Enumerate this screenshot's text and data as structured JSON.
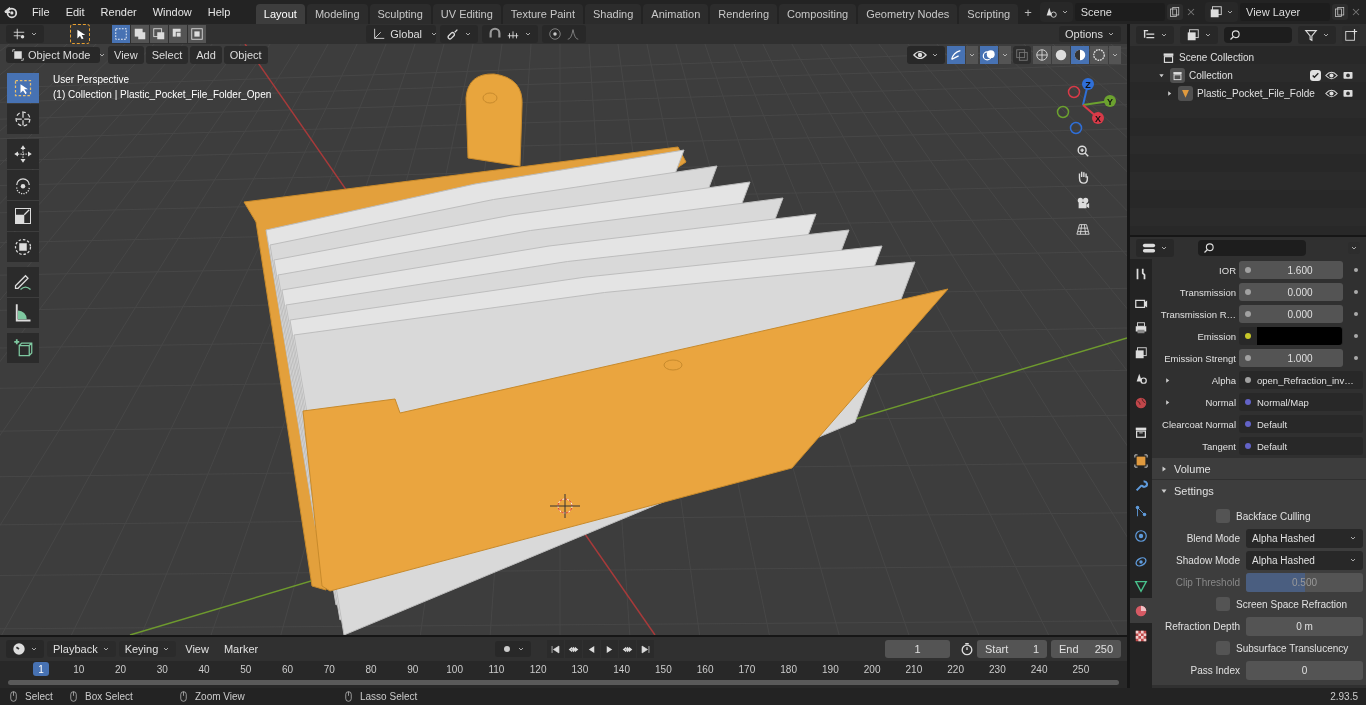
{
  "menu": [
    "File",
    "Edit",
    "Render",
    "Window",
    "Help"
  ],
  "workspaces": [
    {
      "label": "Layout",
      "selected": true
    },
    {
      "label": "Modeling",
      "selected": false
    },
    {
      "label": "Sculpting",
      "selected": false
    },
    {
      "label": "UV Editing",
      "selected": false
    },
    {
      "label": "Texture Paint",
      "selected": false
    },
    {
      "label": "Shading",
      "selected": false
    },
    {
      "label": "Animation",
      "selected": false
    },
    {
      "label": "Rendering",
      "selected": false
    },
    {
      "label": "Compositing",
      "selected": false
    },
    {
      "label": "Geometry Nodes",
      "selected": false
    },
    {
      "label": "Scripting",
      "selected": false
    }
  ],
  "add_workspace": "+",
  "scene": "Scene",
  "view_layer": "View Layer",
  "tool_header": {
    "select_modes": [
      {
        "selected": true
      },
      {
        "selected": false
      },
      {
        "selected": false
      },
      {
        "selected": false
      },
      {
        "selected": false
      }
    ],
    "orientation": "Global",
    "options": "Options"
  },
  "viewport_header": {
    "mode": "Object Mode",
    "menus": [
      "View",
      "Select",
      "Add",
      "Object"
    ],
    "gizmos": true,
    "overlays": true,
    "shading": [
      {
        "selected": false
      },
      {
        "selected": false
      },
      {
        "selected": true
      },
      {
        "selected": false
      }
    ]
  },
  "viewport": {
    "perspective": "User Perspective",
    "info": "(1) Collection | Plastic_Pocket_File_Folder_Open",
    "axes": [
      "Z",
      "Y",
      "X"
    ]
  },
  "toolbar": [
    {
      "kind": "select",
      "selected": true
    },
    {
      "kind": "cursor",
      "selected": false
    },
    {
      "kind": "move",
      "selected": false
    },
    {
      "kind": "rotate",
      "selected": false
    },
    {
      "kind": "scale",
      "selected": false
    },
    {
      "kind": "transform",
      "selected": false
    },
    {
      "kind": "annotate",
      "selected": false
    },
    {
      "kind": "measure",
      "selected": false
    },
    {
      "kind": "add-cube",
      "selected": false
    }
  ],
  "outliner": {
    "items": [
      {
        "label": "Scene Collection",
        "kind": "scene",
        "children": [
          {
            "label": "Collection",
            "kind": "collection",
            "expanded": true,
            "checked": true,
            "children": [
              {
                "label": "Plastic_Pocket_File_Folde",
                "kind": "mesh",
                "expanded": false
              }
            ]
          }
        ]
      }
    ]
  },
  "properties": {
    "tabs": [
      {
        "kind": "tool",
        "selected": false
      },
      {
        "kind": "render",
        "selected": false
      },
      {
        "kind": "output",
        "selected": false
      },
      {
        "kind": "view-layer",
        "selected": false
      },
      {
        "kind": "scene",
        "selected": false
      },
      {
        "kind": "world",
        "selected": false
      },
      {
        "kind": "collection",
        "selected": false
      },
      {
        "kind": "object",
        "selected": false
      },
      {
        "kind": "modifiers",
        "selected": false
      },
      {
        "kind": "particles",
        "selected": false
      },
      {
        "kind": "physics",
        "selected": false
      },
      {
        "kind": "constraints",
        "selected": false
      },
      {
        "kind": "data",
        "selected": false
      },
      {
        "kind": "material",
        "selected": true
      },
      {
        "kind": "texture",
        "selected": false
      }
    ],
    "inputs": [
      {
        "label": "IOR",
        "kind": "value",
        "color": "#a1a1a1",
        "value": "1.600"
      },
      {
        "label": "Transmission",
        "kind": "value",
        "color": "#a1a1a1",
        "value": "0.000"
      },
      {
        "label": "Transmission R…",
        "kind": "value",
        "color": "#a1a1a1",
        "value": "0.000"
      },
      {
        "label": "Emission",
        "kind": "color",
        "color": "#c7c729",
        "swatch": {
          "color": "#000000"
        }
      },
      {
        "label": "Emission Strengt",
        "kind": "value",
        "color": "#a1a1a1",
        "value": "1.000"
      },
      {
        "label": "Alpha",
        "kind": "link",
        "color": "#a1a1a1",
        "value": "open_Refraction_inv…",
        "expanded": false
      },
      {
        "label": "Normal",
        "kind": "link",
        "color": "#6363c7",
        "value": "Normal/Map",
        "expanded": false
      },
      {
        "label": "Clearcoat Normal",
        "kind": "link",
        "color": "#6363c7",
        "value": "Default"
      },
      {
        "label": "Tangent",
        "kind": "link",
        "color": "#6363c7",
        "value": "Default"
      }
    ],
    "panels": [
      {
        "title": "Volume",
        "expanded": false
      },
      {
        "title": "Settings",
        "expanded": true,
        "rows": [
          {
            "kind": "checkbox",
            "label": "Backface Culling",
            "checked": false
          },
          {
            "kind": "dropdown",
            "label": "Blend Mode",
            "value": "Alpha Hashed"
          },
          {
            "kind": "dropdown",
            "label": "Shadow Mode",
            "value": "Alpha Hashed"
          },
          {
            "kind": "slider",
            "label": "Clip Threshold",
            "value": "0.500",
            "level": 0.5,
            "disabled": true
          },
          {
            "kind": "checkbox",
            "label": "Screen Space Refraction",
            "checked": false
          },
          {
            "kind": "number",
            "label": "Refraction Depth",
            "value": "0 m"
          },
          {
            "kind": "checkbox",
            "label": "Subsurface Translucency",
            "checked": false
          },
          {
            "kind": "number",
            "label": "Pass Index",
            "value": "0"
          }
        ]
      }
    ]
  },
  "timeline": {
    "menus": [
      {
        "label": "Playback",
        "kind": "dropdown"
      },
      {
        "label": "Keying",
        "kind": "dropdown"
      },
      {
        "label": "View",
        "kind": "menu"
      },
      {
        "label": "Marker",
        "kind": "menu"
      }
    ],
    "frame": "1",
    "start_label": "Start",
    "start": "1",
    "end_label": "End",
    "end": "250",
    "current": "1",
    "ticks": [
      "10",
      "20",
      "30",
      "40",
      "50",
      "60",
      "70",
      "80",
      "90",
      "100",
      "110",
      "120",
      "130",
      "140",
      "150",
      "160",
      "170",
      "180",
      "190",
      "200",
      "210",
      "220",
      "230",
      "240",
      "250"
    ]
  },
  "status_bar": {
    "hints": [
      "Select",
      "Box Select",
      "Zoom View",
      "Lasso Select"
    ],
    "version": "2.93.5"
  }
}
